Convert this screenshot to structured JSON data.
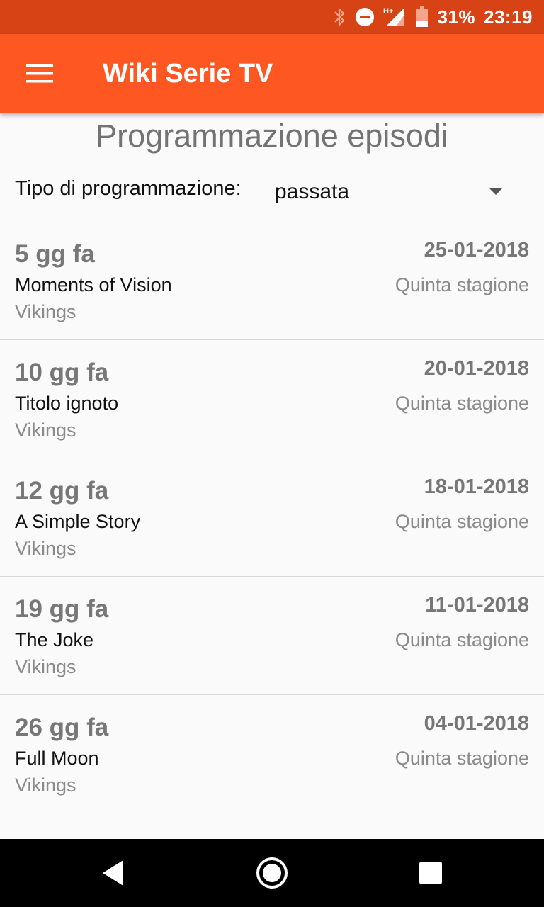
{
  "status_bar": {
    "battery_percent": "31%",
    "time": "23:19",
    "network": "H+",
    "icons": [
      "bluetooth-icon",
      "do-not-disturb-icon",
      "signal-icon",
      "battery-icon"
    ]
  },
  "app_bar": {
    "title": "Wiki Serie TV",
    "menu_icon": "hamburger-menu-icon"
  },
  "page": {
    "title": "Programmazione episodi",
    "filter_label": "Tipo di programmazione:",
    "filter_value": "passata"
  },
  "episodes": [
    {
      "ago": "5 gg fa",
      "date": "25-01-2018",
      "title": "Moments of Vision",
      "season": "Quinta stagione",
      "series": "Vikings"
    },
    {
      "ago": "10 gg fa",
      "date": "20-01-2018",
      "title": "Titolo ignoto",
      "season": "Quinta stagione",
      "series": "Vikings"
    },
    {
      "ago": "12 gg fa",
      "date": "18-01-2018",
      "title": "A Simple Story",
      "season": "Quinta stagione",
      "series": "Vikings"
    },
    {
      "ago": "19 gg fa",
      "date": "11-01-2018",
      "title": "The Joke",
      "season": "Quinta stagione",
      "series": "Vikings"
    },
    {
      "ago": "26 gg fa",
      "date": "04-01-2018",
      "title": "Full Moon",
      "season": "Quinta stagione",
      "series": "Vikings"
    }
  ],
  "nav_bar": {
    "icons": [
      "back-icon",
      "home-icon",
      "recents-icon"
    ]
  },
  "colors": {
    "status_bar": "#d84315",
    "app_bar": "#ff5722",
    "background": "#fafafa"
  }
}
